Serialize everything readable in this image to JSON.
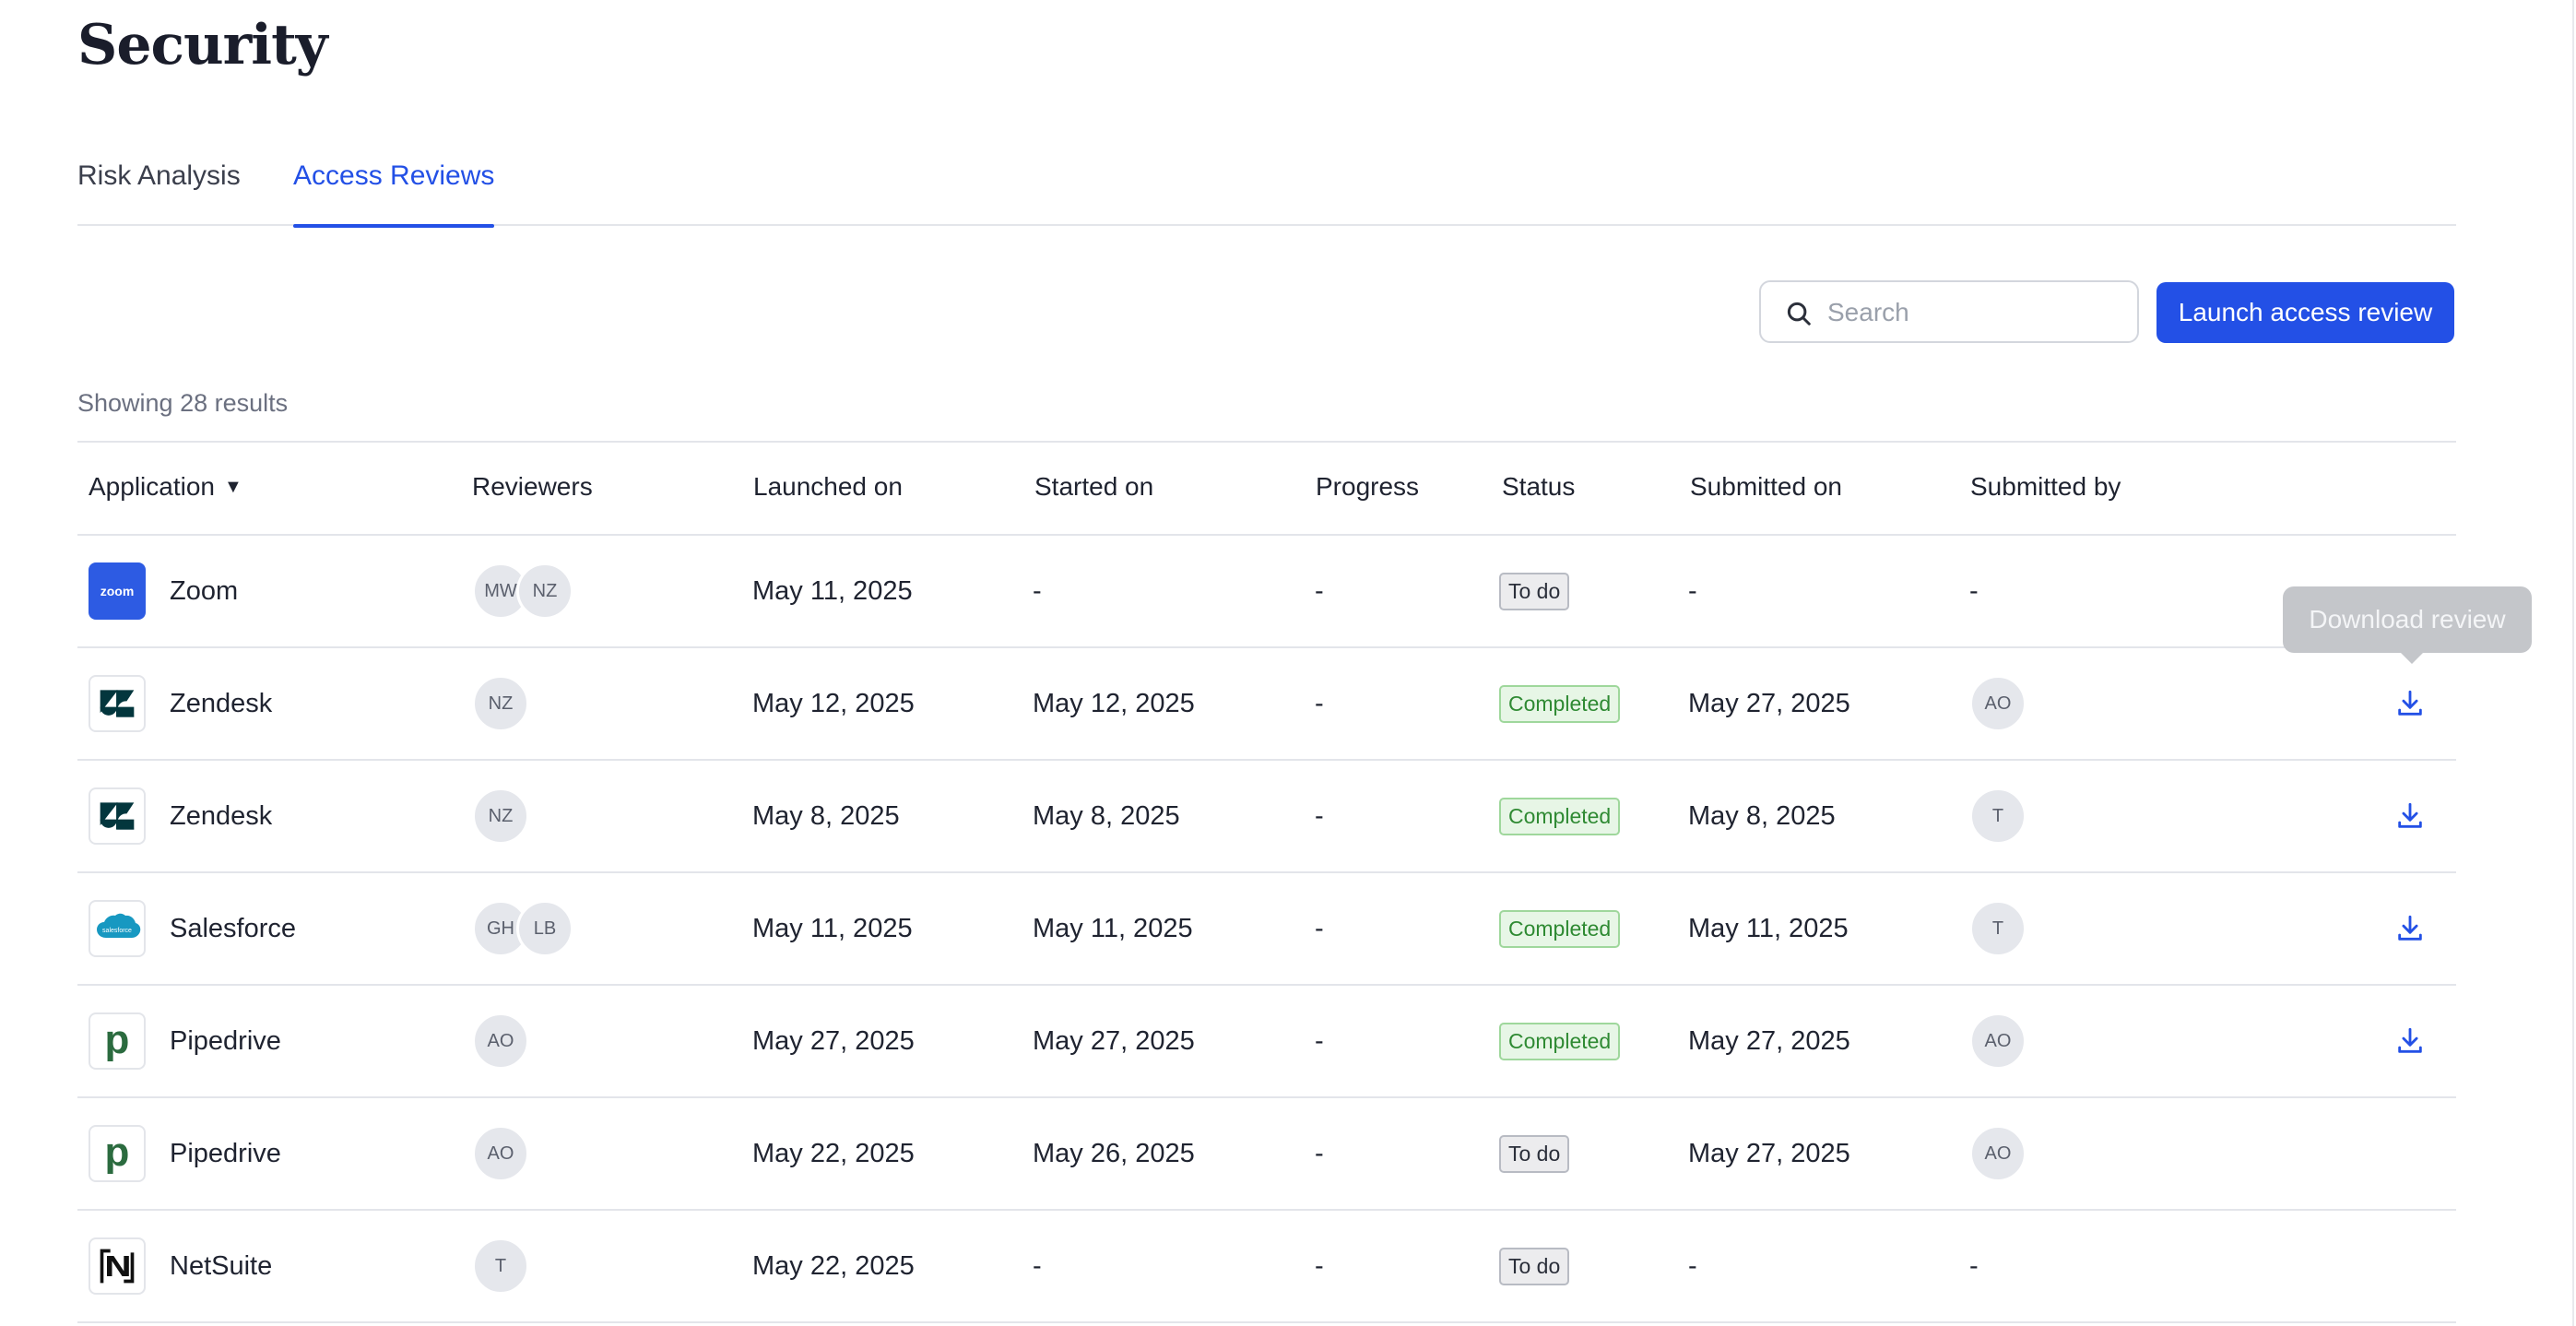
{
  "page": {
    "title": "Security"
  },
  "tabs": [
    {
      "label": "Risk Analysis",
      "active": false
    },
    {
      "label": "Access Reviews",
      "active": true
    }
  ],
  "toolbar": {
    "search_placeholder": "Search",
    "search_value": "",
    "launch_label": "Launch access review"
  },
  "results": {
    "summary": "Showing 28 results"
  },
  "table": {
    "columns": {
      "application": "Application",
      "sort_indicator": "▼",
      "reviewers": "Reviewers",
      "launched_on": "Launched on",
      "started_on": "Started on",
      "progress": "Progress",
      "status": "Status",
      "submitted_on": "Submitted on",
      "submitted_by": "Submitted by"
    },
    "rows": [
      {
        "app": "Zoom",
        "logo": "zoom-logo",
        "reviewers": [
          "MW",
          "NZ"
        ],
        "launched": "May 11, 2025",
        "started": "-",
        "progress": "-",
        "status": "To do",
        "status_kind": "todo",
        "submitted_on": "-",
        "submitted_by": "-",
        "download": false
      },
      {
        "app": "Zendesk",
        "logo": "zendesk-logo",
        "reviewers": [
          "NZ"
        ],
        "launched": "May 12, 2025",
        "started": "May 12, 2025",
        "progress": "-",
        "status": "Completed",
        "status_kind": "completed",
        "submitted_on": "May 27, 2025",
        "submitted_by": "AO",
        "download": true
      },
      {
        "app": "Zendesk",
        "logo": "zendesk-logo",
        "reviewers": [
          "NZ"
        ],
        "launched": "May 8, 2025",
        "started": "May 8, 2025",
        "progress": "-",
        "status": "Completed",
        "status_kind": "completed",
        "submitted_on": "May 8, 2025",
        "submitted_by": "T",
        "download": true
      },
      {
        "app": "Salesforce",
        "logo": "salesforce-logo",
        "reviewers": [
          "GH",
          "LB"
        ],
        "launched": "May 11, 2025",
        "started": "May 11, 2025",
        "progress": "-",
        "status": "Completed",
        "status_kind": "completed",
        "submitted_on": "May 11, 2025",
        "submitted_by": "T",
        "download": true
      },
      {
        "app": "Pipedrive",
        "logo": "pipedrive-logo",
        "reviewers": [
          "AO"
        ],
        "launched": "May 27, 2025",
        "started": "May 27, 2025",
        "progress": "-",
        "status": "Completed",
        "status_kind": "completed",
        "submitted_on": "May 27, 2025",
        "submitted_by": "AO",
        "download": true
      },
      {
        "app": "Pipedrive",
        "logo": "pipedrive-logo",
        "reviewers": [
          "AO"
        ],
        "launched": "May 22, 2025",
        "started": "May 26, 2025",
        "progress": "-",
        "status": "To do",
        "status_kind": "todo",
        "submitted_on": "May 27, 2025",
        "submitted_by": "AO",
        "download": false
      },
      {
        "app": "NetSuite",
        "logo": "netsuite-logo",
        "reviewers": [
          "T"
        ],
        "launched": "May 22, 2025",
        "started": "-",
        "progress": "-",
        "status": "To do",
        "status_kind": "todo",
        "submitted_on": "-",
        "submitted_by": "-",
        "download": false
      }
    ]
  },
  "tooltip": {
    "text": "Download review"
  },
  "colors": {
    "accent": "#2350e6",
    "completed_bg": "#e7f6e6",
    "completed_text": "#2f8a33",
    "todo_bg": "#ececee"
  }
}
